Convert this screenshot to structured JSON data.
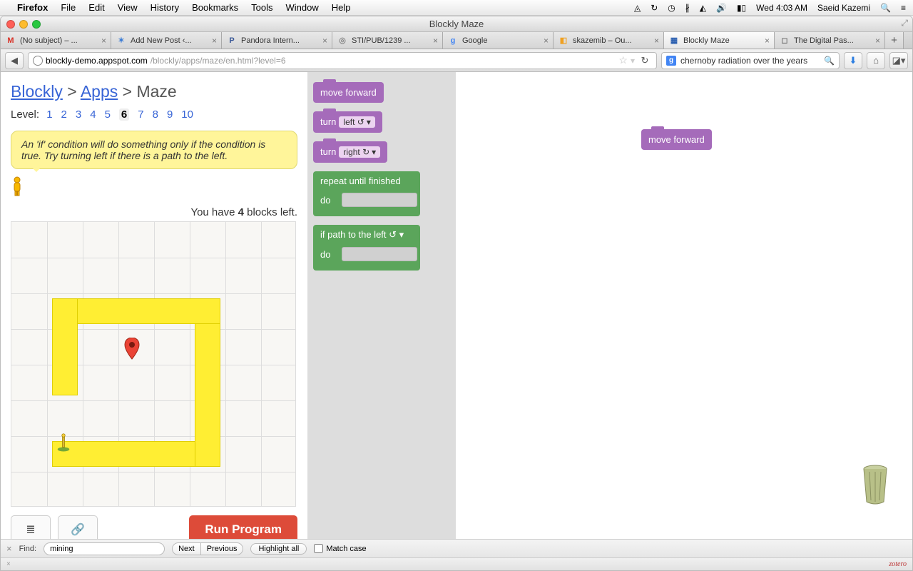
{
  "menubar": {
    "app": "Firefox",
    "items": [
      "File",
      "Edit",
      "View",
      "History",
      "Bookmarks",
      "Tools",
      "Window",
      "Help"
    ],
    "clock": "Wed 4:03 AM",
    "user": "Saeid Kazemi"
  },
  "window": {
    "title": "Blockly Maze"
  },
  "tabs": [
    {
      "label": "(No subject) – ...",
      "favicon": "M",
      "color": "#d93025"
    },
    {
      "label": "Add New Post ‹...",
      "favicon": "✶",
      "color": "#3a7bd5"
    },
    {
      "label": "Pandora Intern...",
      "favicon": "P",
      "color": "#3b5998"
    },
    {
      "label": "STI/PUB/1239 ...",
      "favicon": "◎",
      "color": "#888"
    },
    {
      "label": "Google",
      "favicon": "g",
      "color": "#4285f4"
    },
    {
      "label": "skazemib – Ou...",
      "favicon": "◧",
      "color": "#f0a020"
    },
    {
      "label": "Blockly Maze",
      "favicon": "▦",
      "color": "#2b5fb0",
      "active": true
    },
    {
      "label": "The Digital Pas...",
      "favicon": "◻",
      "color": "#777"
    }
  ],
  "url": {
    "domain": "blockly-demo.appspot.com",
    "path": "/blockly/apps/maze/en.html?level=6"
  },
  "search": {
    "query": "chernoby radiation over the years"
  },
  "breadcrumb": {
    "blockly": "Blockly",
    "apps": "Apps",
    "maze": "Maze"
  },
  "levels": {
    "label": "Level:",
    "items": [
      "1",
      "2",
      "3",
      "4",
      "5",
      "6",
      "7",
      "8",
      "9",
      "10"
    ],
    "current": "6"
  },
  "hint": "An 'if' condition will do something only if the condition is true. Try turning left if there is a path to the left.",
  "counter": {
    "prefix": "You have ",
    "count": "4",
    "suffix": " blocks left."
  },
  "buttons": {
    "run": "Run Program"
  },
  "toolbox": {
    "move_forward": "move forward",
    "turn": "turn",
    "left": "left ↺",
    "right": "right ↻",
    "repeat": "repeat until finished",
    "do": "do",
    "ifpath": "if path",
    "to_left": "to the left ↺"
  },
  "workspace": {
    "block1": "move forward"
  },
  "findbar": {
    "label": "Find:",
    "query": "mining",
    "next": "Next",
    "prev": "Previous",
    "highlight": "Highlight all",
    "matchcase": "Match case"
  },
  "status": {
    "zotero": "zotero"
  }
}
